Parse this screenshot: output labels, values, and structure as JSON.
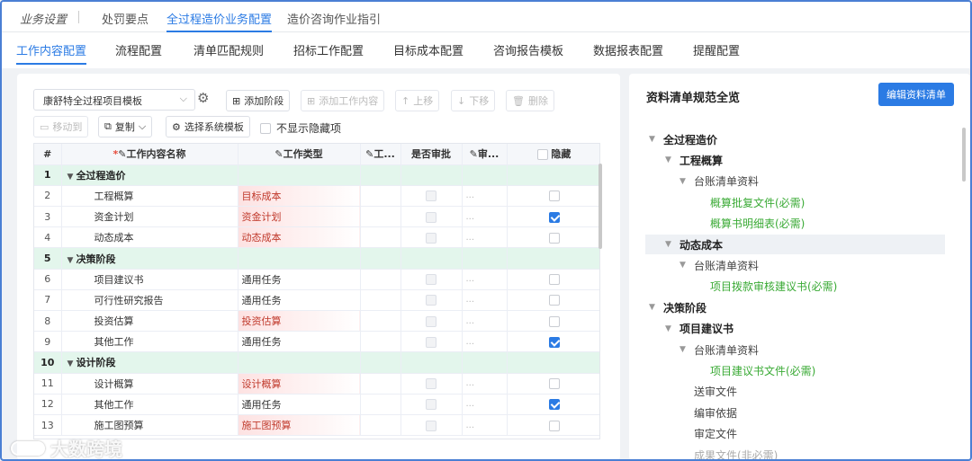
{
  "top_tabs": {
    "section_label": "业务设置",
    "items": [
      {
        "label": "处罚要点",
        "active": false
      },
      {
        "label": "全过程造价业务配置",
        "active": true
      },
      {
        "label": "造价咨询作业指引",
        "active": false
      }
    ]
  },
  "sub_tabs": [
    {
      "label": "工作内容配置",
      "active": true
    },
    {
      "label": "流程配置",
      "active": false
    },
    {
      "label": "清单匹配规则",
      "active": false
    },
    {
      "label": "招标工作配置",
      "active": false
    },
    {
      "label": "目标成本配置",
      "active": false
    },
    {
      "label": "咨询报告模板",
      "active": false
    },
    {
      "label": "数据报表配置",
      "active": false
    },
    {
      "label": "提醒配置",
      "active": false
    }
  ],
  "toolbar": {
    "template_select": "康舒特全过程项目模板",
    "add_stage": "添加阶段",
    "add_content": "添加工作内容",
    "move_up": "上移",
    "move_down": "下移",
    "delete": "删除",
    "move_to": "移动到",
    "copy": "复制",
    "choose_template": "选择系统模板",
    "hide_hidden": "不显示隐藏项"
  },
  "table": {
    "headers": {
      "num": "#",
      "name": "工作内容名称",
      "type": "工作类型",
      "col3": "工...",
      "approval": "是否审批",
      "col5": "审...",
      "hidden": "隐藏"
    },
    "rows": [
      {
        "n": "1",
        "name": "全过程造价",
        "group": true
      },
      {
        "n": "2",
        "name": "工程概算",
        "type": "目标成本",
        "red": true,
        "hidden": false
      },
      {
        "n": "3",
        "name": "资金计划",
        "type": "资金计划",
        "red": true,
        "hidden": true
      },
      {
        "n": "4",
        "name": "动态成本",
        "type": "动态成本",
        "red": true,
        "hidden": false
      },
      {
        "n": "5",
        "name": "决策阶段",
        "group": true
      },
      {
        "n": "6",
        "name": "项目建议书",
        "type": "通用任务",
        "red": false,
        "hidden": false
      },
      {
        "n": "7",
        "name": "可行性研究报告",
        "type": "通用任务",
        "red": false,
        "hidden": false
      },
      {
        "n": "8",
        "name": "投资估算",
        "type": "投资估算",
        "red": true,
        "hidden": false
      },
      {
        "n": "9",
        "name": "其他工作",
        "type": "通用任务",
        "red": false,
        "hidden": true
      },
      {
        "n": "10",
        "name": "设计阶段",
        "group": true
      },
      {
        "n": "11",
        "name": "设计概算",
        "type": "设计概算",
        "red": true,
        "hidden": false
      },
      {
        "n": "12",
        "name": "其他工作",
        "type": "通用任务",
        "red": false,
        "hidden": true
      },
      {
        "n": "13",
        "name": "施工图预算",
        "type": "施工图预算",
        "red": true,
        "hidden": false
      }
    ],
    "dots": "..."
  },
  "right": {
    "title": "资料清单规范全览",
    "edit_button": "编辑资料清单",
    "tree": [
      {
        "label": "全过程造价",
        "level": 0,
        "style": "bold",
        "arrow": true
      },
      {
        "label": "工程概算",
        "level": 1,
        "style": "bold",
        "arrow": true
      },
      {
        "label": "台账清单资料",
        "level": 2,
        "style": "plain",
        "arrow": true
      },
      {
        "label": "概算批复文件(必需)",
        "level": 3,
        "style": "green",
        "arrow": false
      },
      {
        "label": "概算书明细表(必需)",
        "level": 3,
        "style": "green",
        "arrow": false
      },
      {
        "label": "动态成本",
        "level": 1,
        "style": "bold",
        "arrow": true,
        "hilite": true
      },
      {
        "label": "台账清单资料",
        "level": 2,
        "style": "plain",
        "arrow": true
      },
      {
        "label": "项目拨款审核建议书(必需)",
        "level": 3,
        "style": "green",
        "arrow": false
      },
      {
        "label": "决策阶段",
        "level": 0,
        "style": "bold",
        "arrow": true
      },
      {
        "label": "项目建议书",
        "level": 1,
        "style": "bold",
        "arrow": true
      },
      {
        "label": "台账清单资料",
        "level": 2,
        "style": "plain",
        "arrow": true
      },
      {
        "label": "项目建议书文件(必需)",
        "level": 3,
        "style": "green",
        "arrow": false
      },
      {
        "label": "送审文件",
        "level": 2,
        "style": "plain",
        "arrow": false
      },
      {
        "label": "编审依据",
        "level": 2,
        "style": "plain",
        "arrow": false
      },
      {
        "label": "审定文件",
        "level": 2,
        "style": "plain",
        "arrow": false
      },
      {
        "label": "成果文件(非必需)",
        "level": 2,
        "style": "faded",
        "arrow": false
      }
    ]
  },
  "watermark": "大数跨境"
}
